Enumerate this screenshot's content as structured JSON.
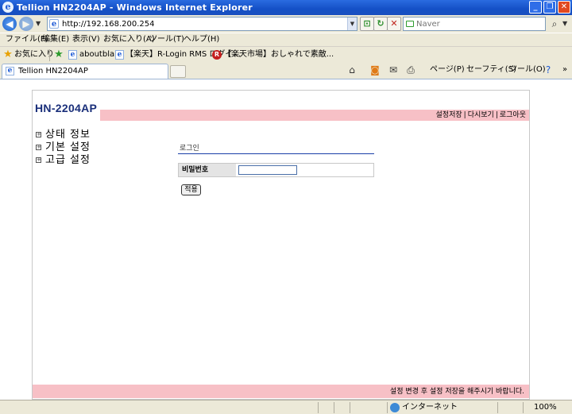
{
  "window": {
    "title": "Tellion HN2204AP - Windows Internet Explorer",
    "minimize": "_",
    "restore": "❐",
    "close": "✕"
  },
  "address_bar": {
    "url": "http://192.168.200.254",
    "search_placeholder": "Naver"
  },
  "menubar": {
    "items": [
      "ファイル(F)",
      "編集(E)",
      "表示(V)",
      "お気に入り(A)",
      "ツール(T)",
      "ヘルプ(H)"
    ]
  },
  "favorites_bar": {
    "favorites_label": "お気に入り",
    "links": [
      "aboutblank",
      "【楽天】R-Login RMS ログイ...",
      "【楽天市場】おしゃれで素敵..."
    ]
  },
  "tabs": {
    "active_label": "Tellion HN2204AP"
  },
  "command_bar": {
    "page": "ページ(P)",
    "safety": "セーフティ(S)",
    "tools": "ツール(O)",
    "more": "»"
  },
  "router_page": {
    "brand": "HN-2204AP",
    "top_links": [
      "설정저장",
      "다시보기",
      "로그아웃"
    ],
    "nav": [
      "상태 정보",
      "기본 설정",
      "고급 설정"
    ],
    "login": {
      "title": "로그인",
      "password_label": "비밀번호",
      "password_value": "",
      "apply_button": "적용"
    },
    "footer_message": "설정 변경 후 설정 저장을 해주시기 바랍니다."
  },
  "statusbar": {
    "zone": "インターネット",
    "zoom": "100%"
  },
  "colors": {
    "titlebar": "#1450c6",
    "band": "#f7c0c6",
    "brand": "#1a2f7a"
  }
}
